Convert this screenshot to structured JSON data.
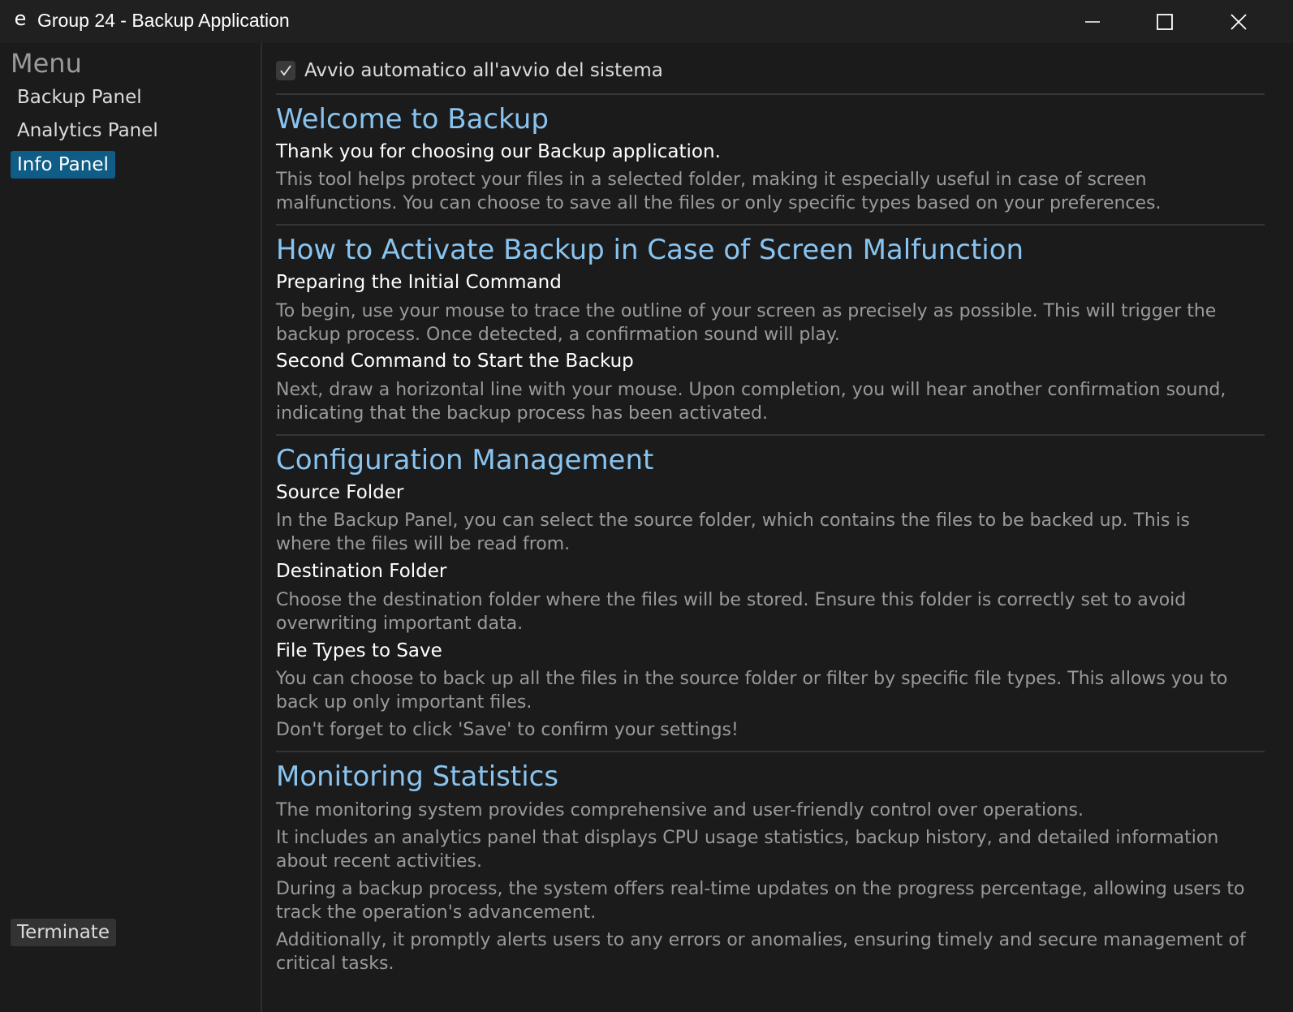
{
  "window": {
    "app_icon_glyph": "e",
    "title": "Group 24 - Backup Application"
  },
  "sidebar": {
    "menu_title": "Menu",
    "items": [
      {
        "label": "Backup Panel",
        "active": false
      },
      {
        "label": "Analytics Panel",
        "active": false
      },
      {
        "label": "Info Panel",
        "active": true
      }
    ],
    "terminate_label": "Terminate"
  },
  "autostart": {
    "label": "Avvio automatico all'avvio del sistema",
    "checked": true
  },
  "welcome": {
    "title": "Welcome to Backup",
    "subtitle": "Thank you for choosing our Backup application.",
    "body": "This tool helps protect your files in a selected folder, making it especially useful in case of screen malfunctions. You can choose to save all the files or only specific types based on your preferences."
  },
  "activate": {
    "title": "How to Activate Backup in Case of Screen Malfunction",
    "step1_title": "Preparing the Initial Command",
    "step1_body": "To begin, use your mouse to trace the outline of your screen as precisely as possible. This will trigger the backup process. Once detected, a confirmation sound will play.",
    "step2_title": "Second Command to Start the Backup",
    "step2_body": "Next, draw a horizontal line with your mouse. Upon completion, you will hear another confirmation sound, indicating that the backup process has been activated."
  },
  "config": {
    "title": "Configuration Management",
    "source_title": "Source Folder",
    "source_body": "In the Backup Panel, you can select the source folder, which contains the files to be backed up. This is where the files will be read from.",
    "dest_title": "Destination Folder",
    "dest_body": "Choose the destination folder where the files will be stored. Ensure this folder is correctly set to avoid overwriting important data.",
    "types_title": "File Types to Save",
    "types_body": "You can choose to back up all the files in the source folder or filter by specific file types. This allows you to back up only important files.",
    "save_note": "Don't forget to click 'Save' to confirm your settings!"
  },
  "monitoring": {
    "title": "Monitoring Statistics",
    "p1": "The monitoring system provides comprehensive and user-friendly control over operations.",
    "p2": "It includes an analytics panel that displays CPU usage statistics, backup history, and detailed information about recent activities.",
    "p3": "During a backup process, the system offers real-time updates on the progress percentage, allowing users to track the operation's advancement.",
    "p4": "Additionally, it promptly alerts users to any errors or anomalies, ensuring timely and secure management of critical tasks."
  },
  "colors": {
    "background": "#1b1b1b",
    "heading": "#89c4f0",
    "active_menu": "#0f5c86",
    "body_text": "#9a9a9a"
  }
}
